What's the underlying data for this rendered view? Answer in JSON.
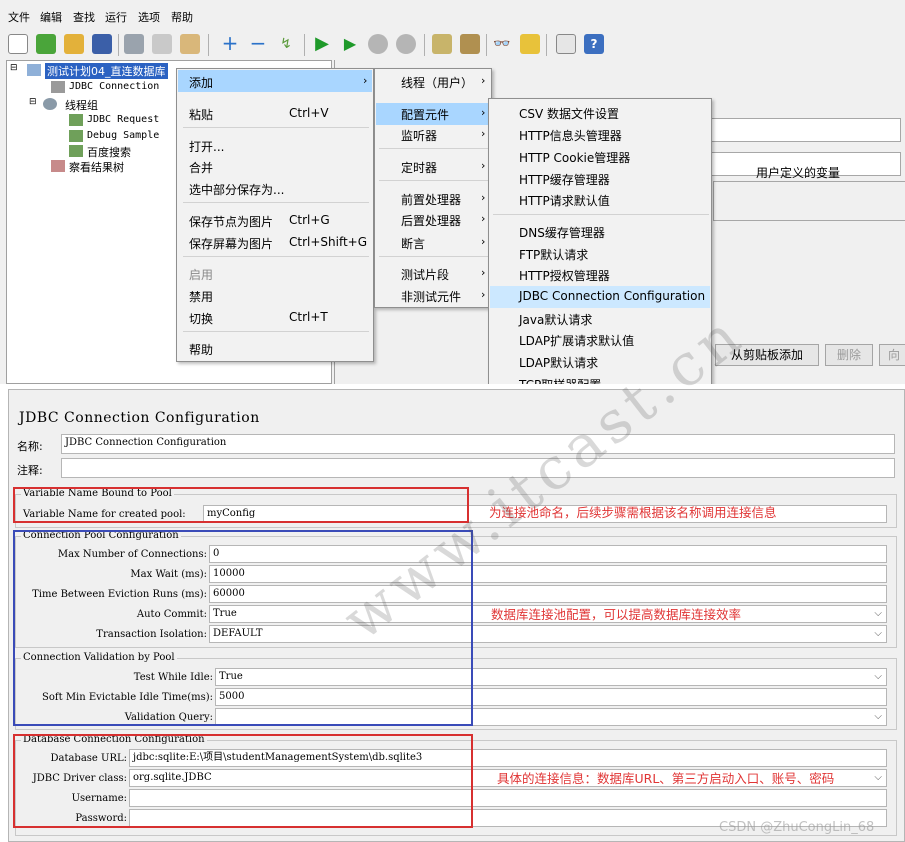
{
  "menubar": [
    "文件",
    "编辑",
    "查找",
    "运行",
    "选项",
    "帮助"
  ],
  "tree": {
    "plan": "测试计划04_直连数据库",
    "jdbc_conn": "JDBC Connection",
    "thread_group": "线程组",
    "jdbc_request": "JDBC Request",
    "debug_sampler": "Debug Sample",
    "baidu": "百度搜索",
    "results_tree": "察看结果树"
  },
  "context_menu": {
    "items": [
      {
        "label": "添加",
        "shortcut": ""
      },
      {
        "label": "粘贴",
        "shortcut": "Ctrl+V"
      },
      {
        "label": "打开...",
        "shortcut": ""
      },
      {
        "label": "合并",
        "shortcut": ""
      },
      {
        "label": "选中部分保存为...",
        "shortcut": ""
      },
      {
        "label": "保存节点为图片",
        "shortcut": "Ctrl+G"
      },
      {
        "label": "保存屏幕为图片",
        "shortcut": "Ctrl+Shift+G"
      },
      {
        "label": "启用",
        "shortcut": ""
      },
      {
        "label": "禁用",
        "shortcut": ""
      },
      {
        "label": "切换",
        "shortcut": "Ctrl+T"
      },
      {
        "label": "帮助",
        "shortcut": ""
      }
    ]
  },
  "submenu_add": [
    "线程（用户）",
    "配置元件",
    "监听器",
    "定时器",
    "前置处理器",
    "后置处理器",
    "断言",
    "测试片段",
    "非测试元件"
  ],
  "submenu_config": [
    "CSV 数据文件设置",
    "HTTP信息头管理器",
    "HTTP Cookie管理器",
    "HTTP缓存管理器",
    "HTTP请求默认值",
    "DNS缓存管理器",
    "FTP默认请求",
    "HTTP授权管理器",
    "JDBC Connection Configuration",
    "Java默认请求",
    "LDAP扩展请求默认值",
    "LDAP默认请求",
    "TCP取样器配置"
  ],
  "right_panel": {
    "udv_header": "用户定义的变量",
    "btn_paste": "从剪贴板添加",
    "btn_delete": "删除",
    "btn_more": "向"
  },
  "config": {
    "title": "JDBC Connection Configuration",
    "name_label": "名称:",
    "name_value": "JDBC Connection Configuration",
    "comment_label": "注释:",
    "vn_group": "Variable Name Bound to Pool",
    "vn_label": "Variable Name for created pool:",
    "vn_value": "myConfig",
    "pool_group": "Connection Pool Configuration",
    "max_conn_label": "Max Number of Connections:",
    "max_conn_value": "0",
    "max_wait_label": "Max Wait (ms):",
    "max_wait_value": "10000",
    "evict_label": "Time Between Eviction Runs (ms):",
    "evict_value": "60000",
    "autocommit_label": "Auto Commit:",
    "autocommit_value": "True",
    "isolation_label": "Transaction Isolation:",
    "isolation_value": "DEFAULT",
    "validation_group": "Connection Validation by Pool",
    "test_idle_label": "Test While Idle:",
    "test_idle_value": "True",
    "soft_min_label": "Soft Min Evictable Idle Time(ms):",
    "soft_min_value": "5000",
    "validation_query_label": "Validation Query:",
    "validation_query_value": "",
    "db_group": "Database Connection Configuration",
    "db_url_label": "Database URL:",
    "db_url_value": "jdbc:sqlite:E:\\项目\\studentManagementSystem\\db.sqlite3",
    "driver_label": "JDBC Driver class:",
    "driver_value": "org.sqlite.JDBC",
    "username_label": "Username:",
    "username_value": "",
    "password_label": "Password:",
    "password_value": ""
  },
  "annotations": {
    "name_note": "为连接池命名，后续步骤需根据该名称调用连接信息",
    "pool_note": "数据库连接池配置，可以提高数据库连接效率",
    "db_note": "具体的连接信息：数据库URL、第三方启动入口、账号、密码"
  },
  "watermarks": {
    "site": "www.itcast.cn",
    "credit": "CSDN @ZhuCongLin_68"
  },
  "colors": {
    "highlight": "#cce8ff",
    "selection": "#2b62c2",
    "red_box": "#d73030",
    "blue_box": "#3a4bb8",
    "note_text": "#e03535"
  }
}
